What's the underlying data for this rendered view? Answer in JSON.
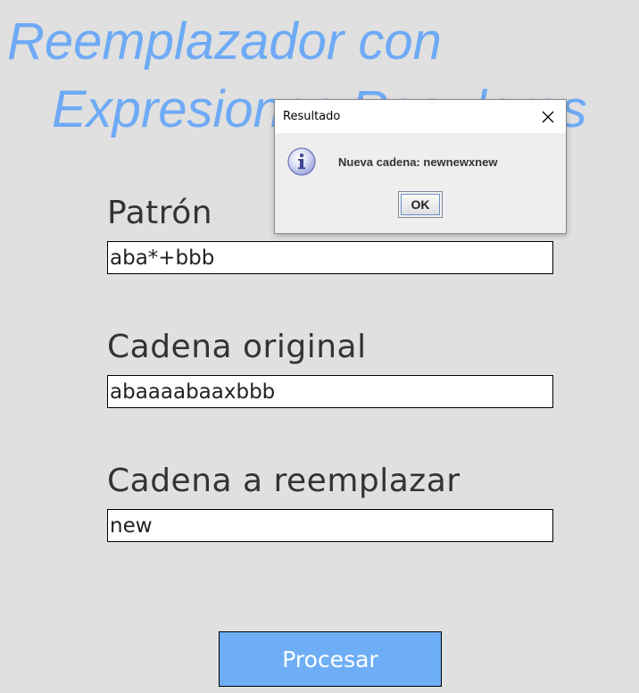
{
  "header": {
    "title_line1": "Reemplazador con",
    "title_line2": "Expresiones Regulares"
  },
  "form": {
    "pattern_label": "Patrón",
    "pattern_value": "aba*+bbb",
    "original_label": "Cadena original",
    "original_value": "abaaaabaaxbbb",
    "replacement_label": "Cadena a reemplazar",
    "replacement_value": "new",
    "process_button": "Procesar"
  },
  "dialog": {
    "title": "Resultado",
    "message": "Nueva cadena: newnewxnew",
    "ok_label": "OK",
    "icon": "info-icon",
    "close_icon": "close-icon"
  },
  "colors": {
    "background": "#e0e0e0",
    "title_accent": "#6eaaf5",
    "button_background": "#6eaef7"
  }
}
